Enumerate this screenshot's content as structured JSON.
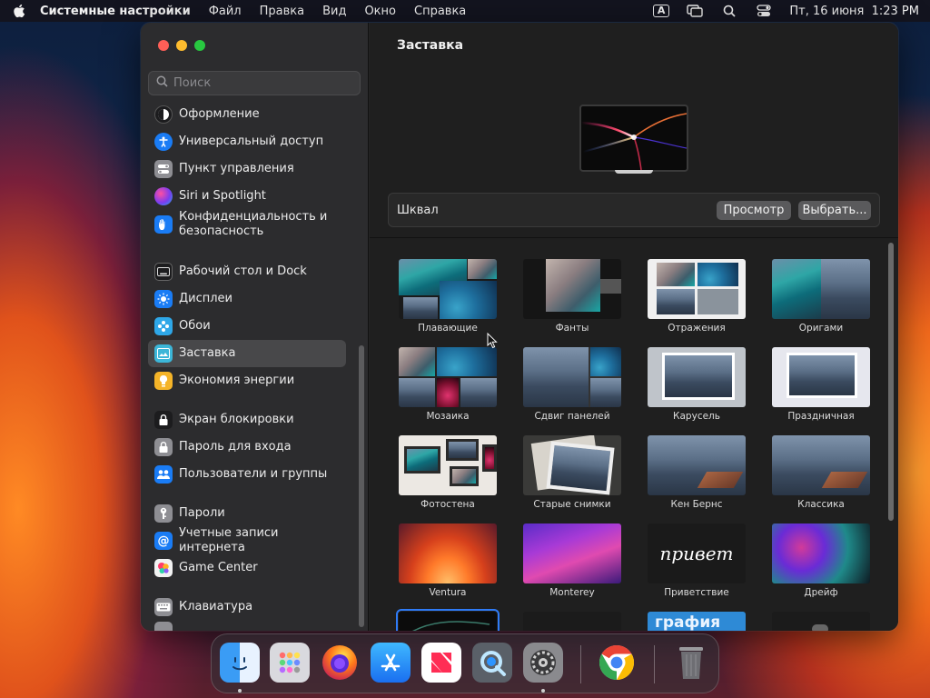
{
  "menubar": {
    "app_name": "Системные настройки",
    "menus": [
      "Файл",
      "Правка",
      "Вид",
      "Окно",
      "Справка"
    ],
    "input_source": "A",
    "datetime": "Пт, 16 июня  1:23 PM"
  },
  "sidebar": {
    "search_placeholder": "Поиск",
    "items": [
      {
        "label": "Оформление",
        "icon": "appearance-icon",
        "color": "#1c1c1e"
      },
      {
        "label": "Универсальный доступ",
        "icon": "accessibility-icon",
        "color": "#1a7cf5"
      },
      {
        "label": "Пункт управления",
        "icon": "control-center-icon",
        "color": "#8e8e93"
      },
      {
        "label": "Siri и Spotlight",
        "icon": "siri-icon",
        "color": "#c23bd4"
      },
      {
        "label": "Конфиденциальность и безопасность",
        "icon": "privacy-hand-icon",
        "color": "#1a7cf5"
      },
      {
        "label": "Рабочий стол и Dock",
        "icon": "desktop-dock-icon",
        "color": "#1c1c1e"
      },
      {
        "label": "Дисплеи",
        "icon": "displays-icon",
        "color": "#1a7cf5"
      },
      {
        "label": "Обои",
        "icon": "wallpaper-icon",
        "color": "#2ea7e8"
      },
      {
        "label": "Заставка",
        "icon": "screensaver-icon",
        "color": "#3cb6d8"
      },
      {
        "label": "Экономия энергии",
        "icon": "battery-icon",
        "color": "#f5b428"
      },
      {
        "label": "Экран блокировки",
        "icon": "lock-screen-icon",
        "color": "#1c1c1e"
      },
      {
        "label": "Пароль для входа",
        "icon": "login-password-icon",
        "color": "#8e8e93"
      },
      {
        "label": "Пользователи и группы",
        "icon": "users-icon",
        "color": "#1a7cf5"
      },
      {
        "label": "Пароли",
        "icon": "key-icon",
        "color": "#8e8e93"
      },
      {
        "label": "Учетные записи интернета",
        "icon": "at-icon",
        "color": "#1a7cf5"
      },
      {
        "label": "Game Center",
        "icon": "game-center-icon",
        "color": "#f2f2f2"
      },
      {
        "label": "Клавиатура",
        "icon": "keyboard-icon",
        "color": "#8e8e93"
      }
    ],
    "selected": "Заставка"
  },
  "main": {
    "title": "Заставка",
    "current_saver": "Шквал",
    "preview_button": "Просмотр",
    "choose_button": "Выбрать..."
  },
  "screensavers": [
    {
      "label": "Плавающие",
      "art": "sea"
    },
    {
      "label": "Фанты",
      "art": "rock"
    },
    {
      "label": "Отражения",
      "art": "coral"
    },
    {
      "label": "Оригами",
      "art": "mtn"
    },
    {
      "label": "Мозаика",
      "art": "coral"
    },
    {
      "label": "Сдвиг панелей",
      "art": "mtn"
    },
    {
      "label": "Карусель",
      "art": "mtn"
    },
    {
      "label": "Праздничная",
      "art": "mtn"
    },
    {
      "label": "Фотостена",
      "art": "frames"
    },
    {
      "label": "Старые снимки",
      "art": "mtn"
    },
    {
      "label": "Кен Бернс",
      "art": "mtn"
    },
    {
      "label": "Классика",
      "art": "mtn"
    },
    {
      "label": "Ventura",
      "art": "ventura"
    },
    {
      "label": "Monterey",
      "art": "monterey"
    },
    {
      "label": "Приветствие",
      "art": "hello",
      "text": "привет"
    },
    {
      "label": "Дрейф",
      "art": "drift"
    },
    {
      "label": "",
      "art": "flurry",
      "selected": true
    },
    {
      "label": "",
      "art": "dark"
    },
    {
      "label": "",
      "art": "word",
      "text": "графия"
    },
    {
      "label": "",
      "art": "dark2"
    }
  ],
  "dock": {
    "apps": [
      "Finder",
      "Launchpad",
      "Firefox",
      "App Store",
      "News",
      "QuickTime Player",
      "System Settings",
      "Google Chrome",
      "Trash"
    ]
  },
  "colors": {
    "accent": "#2f7bf6",
    "sidebar_selected": "#48484a"
  }
}
